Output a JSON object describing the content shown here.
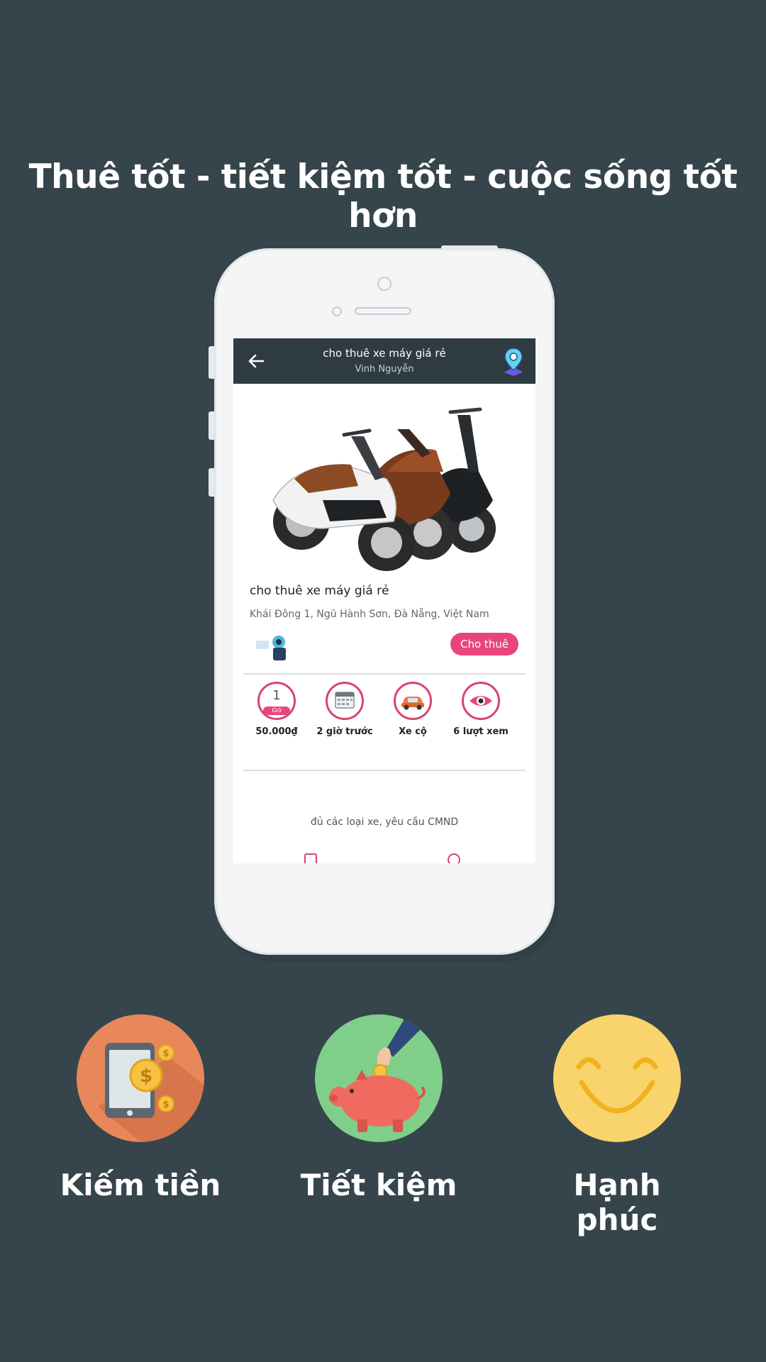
{
  "headline": "Thuê tốt - tiết kiệm tốt - cuộc sống tốt hơn",
  "appbar": {
    "title": "cho thuê xe máy giá rẻ",
    "subtitle": "Vinh Nguyễn",
    "back_icon": "arrow-left-icon",
    "map_icon": "map-pin-icon"
  },
  "listing": {
    "title": "cho thuê xe máy giá rẻ",
    "address": "Khái Đông 1, Ngũ Hành Sơn, Đà Nẵng, Việt Nam",
    "action_label": "Cho thuê",
    "description": "đủ các loại xe, yêu cầu CMND"
  },
  "stats": [
    {
      "icon": "price-per-hour-icon",
      "badge_number": "1",
      "badge_unit": "Giờ",
      "label": "50.000₫"
    },
    {
      "icon": "calendar-icon",
      "label": "2 giờ trước"
    },
    {
      "icon": "car-icon",
      "label": "Xe cộ"
    },
    {
      "icon": "eye-icon",
      "label": "6 lượt xem"
    }
  ],
  "features": [
    {
      "icon": "phone-money-icon",
      "label": "Kiếm tiền",
      "color": "#e8885a"
    },
    {
      "icon": "piggy-bank-icon",
      "label": "Tiết kiệm",
      "color": "#7fcf8a"
    },
    {
      "icon": "smiley-icon",
      "label": "Hạnh phúc",
      "color": "#f9d46c"
    }
  ],
  "colors": {
    "background": "#36454c",
    "appbar": "#2f3b42",
    "accent": "#e8467a"
  }
}
